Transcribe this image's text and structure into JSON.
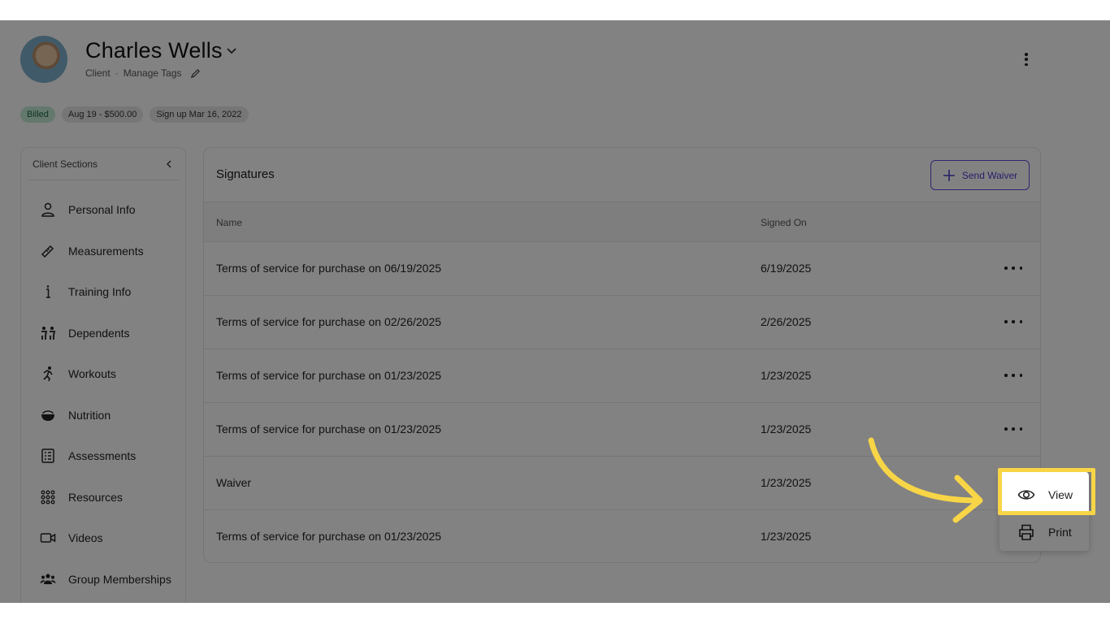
{
  "header": {
    "client_name": "Charles Wells",
    "role": "Client",
    "separator": "·",
    "manage_tags": "Manage Tags"
  },
  "chips": {
    "billed": "Billed",
    "payment": "Aug 19 - $500.00",
    "signup": "Sign up Mar 16, 2022"
  },
  "sidebar": {
    "title": "Client Sections",
    "items": [
      {
        "label": "Personal Info",
        "icon": "person-icon"
      },
      {
        "label": "Measurements",
        "icon": "ruler-icon"
      },
      {
        "label": "Training Info",
        "icon": "info-icon"
      },
      {
        "label": "Dependents",
        "icon": "family-icon"
      },
      {
        "label": "Workouts",
        "icon": "running-icon"
      },
      {
        "label": "Nutrition",
        "icon": "bowl-icon"
      },
      {
        "label": "Assessments",
        "icon": "checklist-icon"
      },
      {
        "label": "Resources",
        "icon": "grid-icon"
      },
      {
        "label": "Videos",
        "icon": "video-icon"
      },
      {
        "label": "Group Memberships",
        "icon": "group-icon"
      }
    ]
  },
  "signatures": {
    "title": "Signatures",
    "send_button": "Send Waiver",
    "columns": {
      "name": "Name",
      "signed_on": "Signed On"
    },
    "rows": [
      {
        "name": "Terms of service for purchase on 06/19/2025",
        "signed_on": "6/19/2025"
      },
      {
        "name": "Terms of service for purchase on 02/26/2025",
        "signed_on": "2/26/2025"
      },
      {
        "name": "Terms of service for purchase on 01/23/2025",
        "signed_on": "1/23/2025"
      },
      {
        "name": "Terms of service for purchase on 01/23/2025",
        "signed_on": "1/23/2025"
      },
      {
        "name": "Waiver",
        "signed_on": "1/23/2025"
      },
      {
        "name": "Terms of service for purchase on 01/23/2025",
        "signed_on": "1/23/2025"
      }
    ]
  },
  "row_menu": {
    "view": "View",
    "print": "Print"
  },
  "colors": {
    "accent": "#4b3fce",
    "highlight": "#f7d547",
    "billed_bg": "#c4ecd8"
  }
}
